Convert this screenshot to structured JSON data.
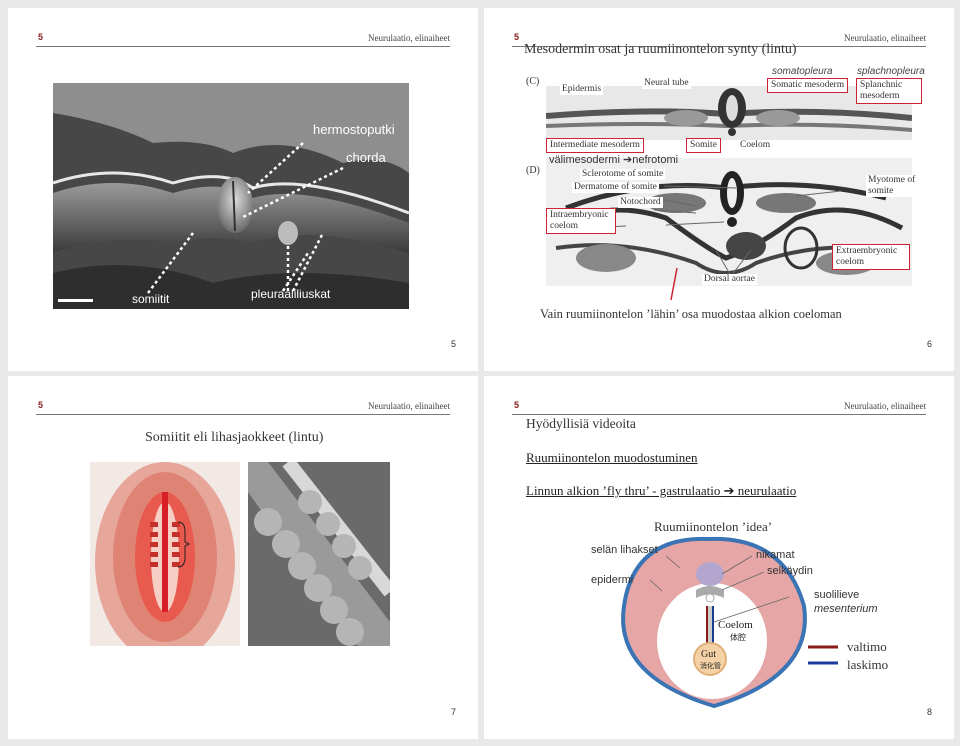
{
  "header_text": "Neurulaatio, elinaiheet",
  "header_num": "5",
  "slide1": {
    "labels": {
      "hermostoputki": "hermostoputki",
      "chorda": "chorda",
      "somiitit": "somiitit",
      "pleura": "pleuraaliliuskat"
    },
    "page": "5"
  },
  "slide2": {
    "title": "Mesodermin osat ja ruumiinontelon synty (lintu)",
    "c": "(C)",
    "d": "(D)",
    "epidermis": "Epidermis",
    "neural_tube": "Neural tube",
    "somatopleura": "somatopleura",
    "splachnopleura": "splachnopleura",
    "somatic_mesoderm": "Somatic mesoderm",
    "splanchnic_mesoderm": "Splanchnic mesoderm",
    "intermediate_mesoderm": "Intermediate mesoderm",
    "somite": "Somite",
    "coelom": "Coelom",
    "valimeso": "välimesodermi",
    "nefrotomi": "nefrotomi",
    "sclerotome": "Sclerotome of somite",
    "dermatome": "Dermatome of somite",
    "myotome": "Myotome of somite",
    "notochord": "Notochord",
    "intraembryonic": "Intraembryonic coelom",
    "extraembryonic": "Extraembryonic coelom",
    "dorsal_aortae": "Dorsal aortae",
    "caption": "Vain ruumiinontelon ’lähin’ osa muodostaa alkion coeloman",
    "page": "6"
  },
  "slide3": {
    "title": "Somiitit eli lihasjaokkeet (lintu)",
    "page": "7"
  },
  "slide4": {
    "title": "Hyödyllisiä videoita",
    "link1": "Ruumiinontelon muodostuminen",
    "link2": "Linnun alkion ’fly thru’ - gastrulaatio",
    "link2b": "neurulaatio",
    "idea_title": "Ruumiinontelon ’idea’",
    "selan": "selän lihakset",
    "epidermi": "epidermi",
    "nikamat": "nikamat",
    "selkaydin": "selkäydin",
    "suolilieve": "suolilieve",
    "mesenterium": "mesenterium",
    "coelom": "Coelom",
    "coelom_cn": "体腔",
    "gut": "Gut",
    "gut_cn": "消化管",
    "valtimo": "valtimo",
    "laskimo": "laskimo",
    "page": "8"
  },
  "colors": {
    "valtimo": "#8b1a1a",
    "laskimo": "#1c3c9c",
    "accent": "#c22"
  }
}
